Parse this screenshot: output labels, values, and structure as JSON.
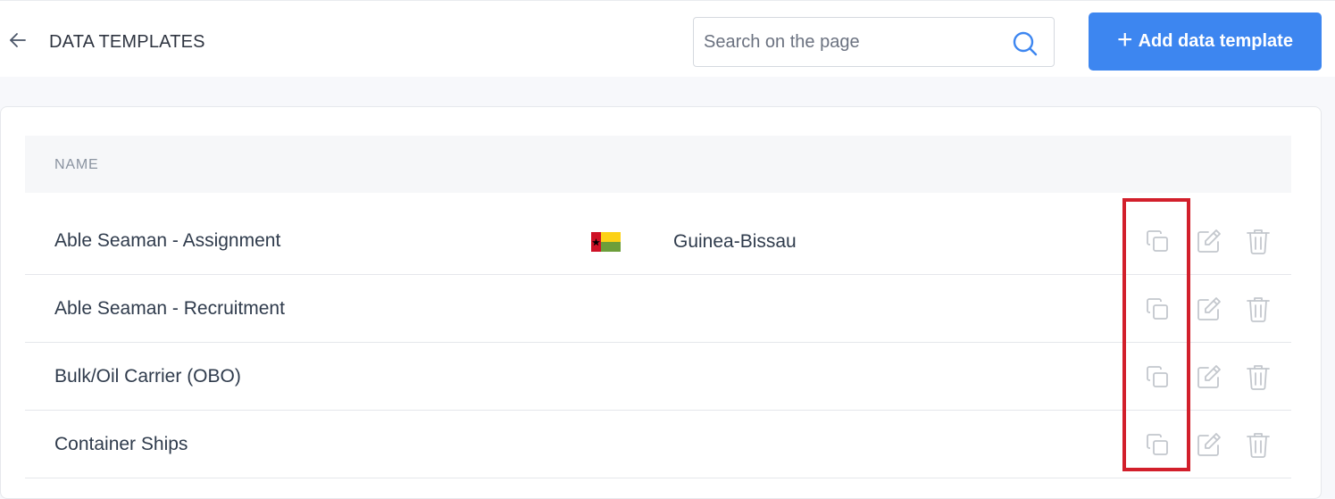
{
  "header": {
    "title": "DATA TEMPLATES",
    "search_placeholder": "Search on the page",
    "add_button_label": "Add data template",
    "accent_color": "#3d86f0"
  },
  "table": {
    "columns": [
      "NAME"
    ],
    "rows": [
      {
        "name": "Able Seaman - Assignment",
        "country": "Guinea-Bissau",
        "flag": "guinea-bissau-flag"
      },
      {
        "name": "Able Seaman - Recruitment",
        "country": "",
        "flag": ""
      },
      {
        "name": "Bulk/Oil Carrier (OBO)",
        "country": "",
        "flag": ""
      },
      {
        "name": "Container Ships",
        "country": "",
        "flag": ""
      }
    ],
    "row_actions": [
      "copy-icon",
      "edit-icon",
      "trash-icon"
    ]
  },
  "annotation": {
    "highlight_color": "#d21f2b"
  }
}
